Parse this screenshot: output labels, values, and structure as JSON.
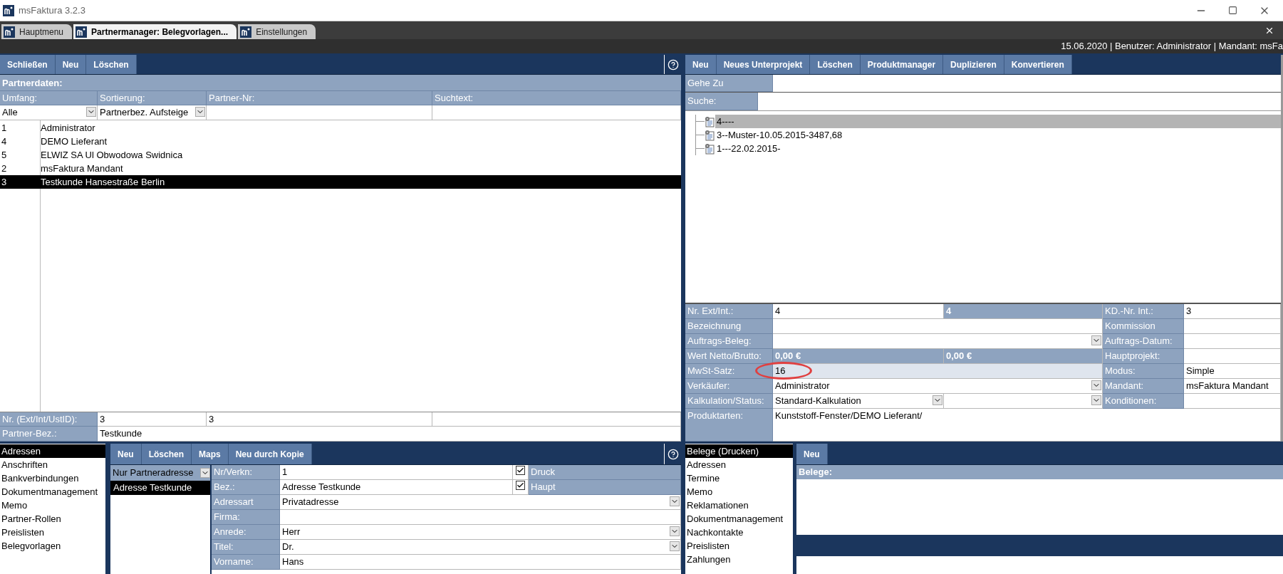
{
  "window": {
    "title": "msFaktura 3.2.3"
  },
  "tabs": [
    {
      "label": "Hauptmenu",
      "selected": false
    },
    {
      "label": "Partnermanager: Belegvorlagen...",
      "selected": true
    },
    {
      "label": "Einstellungen",
      "selected": false
    }
  ],
  "status_text": "15.06.2020 | Benutzer: Administrator | Mandant: msFa",
  "partner_panel": {
    "toolbar": [
      "Schließen",
      "Neu",
      "Löschen"
    ],
    "section_title": "Partnerdaten:",
    "filters": [
      {
        "label": "Umfang:",
        "value": "Alle",
        "kind": "select"
      },
      {
        "label": "Sortierung:",
        "value": "Partnerbez. Aufsteige",
        "kind": "select"
      },
      {
        "label": "Partner-Nr:",
        "kind": "text"
      },
      {
        "label": "Suchtext:",
        "kind": "text"
      }
    ],
    "partners": [
      {
        "nr": "1",
        "name": "Administrator",
        "selected": false
      },
      {
        "nr": "4",
        "name": "DEMO Lieferant",
        "selected": false
      },
      {
        "nr": "5",
        "name": "ELWIZ SA Ul Obwodowa Swidnica",
        "selected": false
      },
      {
        "nr": "2",
        "name": "msFaktura Mandant",
        "selected": false
      },
      {
        "nr": "3",
        "name": "Testkunde Hansestraße Berlin",
        "selected": true
      }
    ],
    "nr_label": "Nr. (Ext/Int/UstID):",
    "nr_values": [
      "3",
      "3"
    ],
    "bez_label": "Partner-Bez.:",
    "bez_value": "Testkunde"
  },
  "partner_sections": [
    {
      "label": "Adressen",
      "selected": true
    },
    {
      "label": "Anschriften",
      "selected": false
    },
    {
      "label": "Bankverbindungen",
      "selected": false
    },
    {
      "label": "Dokumentmanagement",
      "selected": false
    },
    {
      "label": "Memo",
      "selected": false
    },
    {
      "label": "Partner-Rollen",
      "selected": false
    },
    {
      "label": "Preislisten",
      "selected": false
    },
    {
      "label": "Belegvorlagen",
      "selected": false
    }
  ],
  "address_panel": {
    "toolbar": [
      "Neu",
      "Löschen",
      "Maps",
      "Neu durch Kopie"
    ],
    "filter": "Nur Partneradresse",
    "addresses": [
      {
        "label": "Adresse Testkunde",
        "selected": true
      }
    ],
    "fields": [
      {
        "label": "Nr/Verkn:",
        "value": "1",
        "kind": "check",
        "checked": true,
        "check_label": "Druck"
      },
      {
        "label": "Bez.:",
        "value": "Adresse Testkunde",
        "kind": "check",
        "checked": true,
        "check_label": "Haupt"
      },
      {
        "label": "Adressart",
        "value": "Privatadresse",
        "kind": "select"
      },
      {
        "label": "Firma:",
        "kind": "text"
      },
      {
        "label": "Anrede:",
        "value": "Herr",
        "kind": "select"
      },
      {
        "label": "Titel:",
        "value": "Dr.",
        "kind": "select"
      },
      {
        "label": "Vorname:",
        "value": "Hans",
        "kind": "text"
      }
    ]
  },
  "project_panel": {
    "toolbar": [
      "Neu",
      "Neues Unterprojekt",
      "Löschen",
      "Produktmanager",
      "Duplizieren",
      "Konvertieren"
    ],
    "goto_label": "Gehe Zu",
    "search_label": "Suche:",
    "tree": [
      {
        "label": "4----",
        "selected": true
      },
      {
        "label": "3--Muster-10.05.2015-3487,68",
        "selected": false
      },
      {
        "label": "1---22.02.2015-",
        "selected": false
      }
    ],
    "form": [
      {
        "label": "Nr. Ext/Int.:",
        "values": [
          {
            "text": "4",
            "kind": "text"
          },
          {
            "text": "4",
            "kind": "readonly"
          }
        ],
        "side_label": "KD.-Nr. Int.:",
        "side_value": "3"
      },
      {
        "label": "Bezeichnung",
        "values": [
          {
            "kind": "text"
          }
        ],
        "side_label": "Kommission"
      },
      {
        "label": "Auftrags-Beleg:",
        "values": [
          {
            "kind": "select"
          }
        ],
        "side_label": "Auftrags-Datum:"
      },
      {
        "label": "Wert Netto/Brutto:",
        "values": [
          {
            "text": "0,00 €",
            "kind": "readonly"
          },
          {
            "text": "0,00 €",
            "kind": "readonly"
          }
        ],
        "side_label": "Hauptprojekt:"
      },
      {
        "label": "MwSt-Satz:",
        "values": [
          {
            "text": "16",
            "kind": "focused"
          }
        ],
        "side_label": "Modus:",
        "side_value": "Simple"
      },
      {
        "label": "Verkäufer:",
        "values": [
          {
            "text": "Administrator",
            "kind": "select"
          }
        ],
        "side_label": "Mandant:",
        "side_value": "msFaktura Mandant"
      },
      {
        "label": "Kalkulation/Status:",
        "values": [
          {
            "text": "Standard-Kalkulation",
            "kind": "select"
          },
          {
            "kind": "select"
          }
        ],
        "side_label": "Konditionen:"
      },
      {
        "label": "Produktarten:",
        "values": [
          {
            "text": "Kunststoff-Fenster/DEMO Lieferant/",
            "kind": "memo"
          }
        ]
      }
    ]
  },
  "project_sections": [
    {
      "label": "Belege (Drucken)",
      "selected": true
    },
    {
      "label": "Adressen",
      "selected": false
    },
    {
      "label": "Termine",
      "selected": false
    },
    {
      "label": "Memo",
      "selected": false
    },
    {
      "label": "Reklamationen",
      "selected": false
    },
    {
      "label": "Dokumentmanagement",
      "selected": false
    },
    {
      "label": "Nachkontakte",
      "selected": false
    },
    {
      "label": "Preislisten",
      "selected": false
    },
    {
      "label": "Zahlungen",
      "selected": false
    }
  ],
  "belege_panel": {
    "toolbar": [
      "Neu"
    ],
    "title": "Belege:"
  }
}
